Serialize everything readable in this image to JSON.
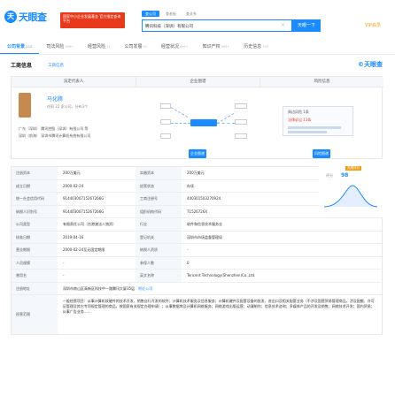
{
  "brand": {
    "logo_mark": "天",
    "name": "天眼查",
    "accent": "#1a8cff",
    "promo_color": "#e8391c"
  },
  "promo": {
    "text": "国家中小企业发展基金 官方指定查询平台"
  },
  "search": {
    "tabs": [
      "查公司",
      "查老板",
      "查关系"
    ],
    "value": "腾讯科技（深圳）有限公司",
    "button": "天眼一下"
  },
  "vip": "VIP会员",
  "nav": [
    {
      "label": "公司背景",
      "count": "115"
    },
    {
      "label": "司法风险",
      "count": "999+"
    },
    {
      "label": "经营风险",
      "count": "11"
    },
    {
      "label": "公司发展",
      "count": "91"
    },
    {
      "label": "经营状况",
      "count": "999+"
    },
    {
      "label": "知识产权",
      "count": "999+"
    },
    {
      "label": "历史信息",
      "count": "193"
    }
  ],
  "section": {
    "title": "工商信息",
    "link": "工商信息",
    "logo": "©天眼查"
  },
  "summary": {
    "col_heads": [
      "法定代表人",
      "企业图谱",
      "风险信息"
    ],
    "person": {
      "name": "马化腾",
      "sub": "任职 22 家公司，分布3个",
      "lines": [
        "广东（深圳） 腾讯控股（深圳）有限公司 等",
        "深圳（前海） 深圳市腾讯计算机系统有限公司"
      ]
    },
    "graph_buttons": [
      "企业图谱",
      "风险图谱"
    ],
    "risk": {
      "title": "周边风险 1条",
      "item": "法律诉讼 11条"
    }
  },
  "score": {
    "label": "评分",
    "value": "98",
    "badge": "天眼评分"
  },
  "info_rows": [
    {
      "k1": "注册资本",
      "v1": "200万美元",
      "k2": "实缴资本",
      "v2": "200万美元"
    },
    {
      "k1": "成立日期",
      "v1": "2000-02-24",
      "k2": "经营状态",
      "v2": "存续"
    },
    {
      "k1": "统一社会信用代码",
      "v1": "91440300715267266G",
      "k2": "工商注册号",
      "v2": "440301503270924"
    },
    {
      "k1": "纳税人识别号",
      "v1": "91440300715267266G",
      "k2": "组织机构代码",
      "v2": "71526726X"
    },
    {
      "k1": "公司类型",
      "v1": "有限责任公司（台港澳法人独资）",
      "k2": "行业",
      "v2": "软件和信息技术服务业"
    },
    {
      "k1": "核准日期",
      "v1": "2019-04-16",
      "k2": "登记机关",
      "v2": "深圳市市场监督管理局"
    },
    {
      "k1": "营业期限",
      "v1": "2000-02-24至无固定期限",
      "k2": "纳税人资质",
      "v2": "-"
    },
    {
      "k1": "人员规模",
      "v1": "-",
      "k2": "参保人数",
      "v2": "0"
    },
    {
      "k1": "曾用名",
      "v1": "-",
      "k2": "英文名称",
      "v2": "Tencent Technology(Shenzhen)Co.,Ltd."
    }
  ],
  "address": {
    "label": "注册地址",
    "value": "深圳市南山区高新区科技中一路腾讯大厦35层",
    "link": "附近公司"
  },
  "scope": {
    "label": "经营范围",
    "text": "一般经营项目：从事计算机软硬件的技术开发，销售自行开发的软件；计算机技术服务及信息服务；计算机硬件及配套设备的批发、进出口及相关配套业务（不涉及国营贸易管理商品，涉及配额、许可证管理及其它专项规定管理的商品，按国家有关规定办理申请）；从事数据库及计算机网络服务；网络游戏出版运营；动漫制作；信息技术咨询；多媒体产品的开发及销售；网络技术开发；国内贸易；从事广告业务……"
  }
}
